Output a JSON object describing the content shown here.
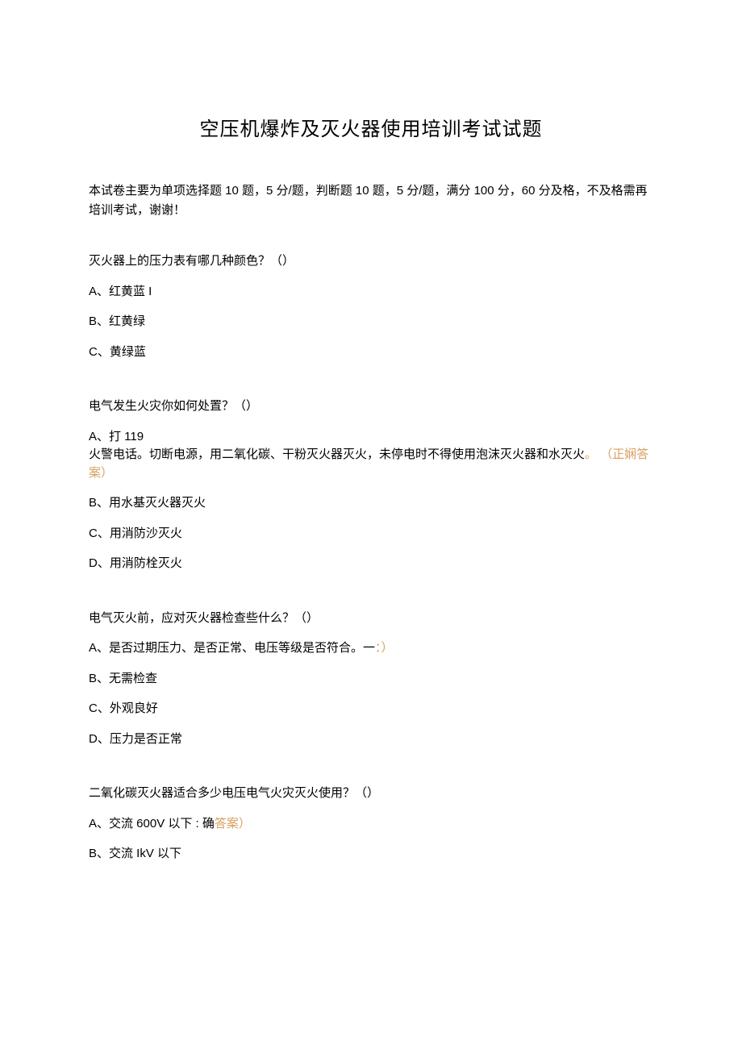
{
  "title": "空压机爆炸及灭火器使用培训考试试题",
  "intro": "本试卷主要为单项选择题 10 题，5 分/题，判断题 10 题，5 分/题，满分 100 分，60 分及格，不及格需再培训考试，谢谢！",
  "q1": {
    "text": "灭火器上的压力表有哪几种颜色？（）",
    "a": "A、红黄蓝 I",
    "b": "B、红黄绿",
    "c": "C、黄绿蓝"
  },
  "q2": {
    "text": "电气发生火灾你如何处置？（）",
    "a_prefix": "A、打 119",
    "a_body": "火警电话。切断电源，用二氧化碳、干粉灭火器灭火，未停电时不得使用泡沫灭火器和水灭火",
    "a_dot": "。",
    "a_answer": "（正娴答案）",
    "b": "B、用水基灭火器灭火",
    "c": "C、用消防沙灭火",
    "d": "D、用消防栓灭火"
  },
  "q3": {
    "text": "电气灭火前，应对灭火器检查些什么？（）",
    "a_text": "A、是否过期压力、是否正常、电压等级是否符合。一",
    "a_tail": "：）",
    "b": "B、无需检查",
    "c": "C、外观良好",
    "d": "D、压力是否正常"
  },
  "q4": {
    "text": "二氧化碳灭火器适合多少电压电气火灾灭火使用？（）",
    "a_text": "A、交流 600V 以下 : 确",
    "a_tail": "答案）",
    "b": "B、交流 IkV 以下"
  }
}
